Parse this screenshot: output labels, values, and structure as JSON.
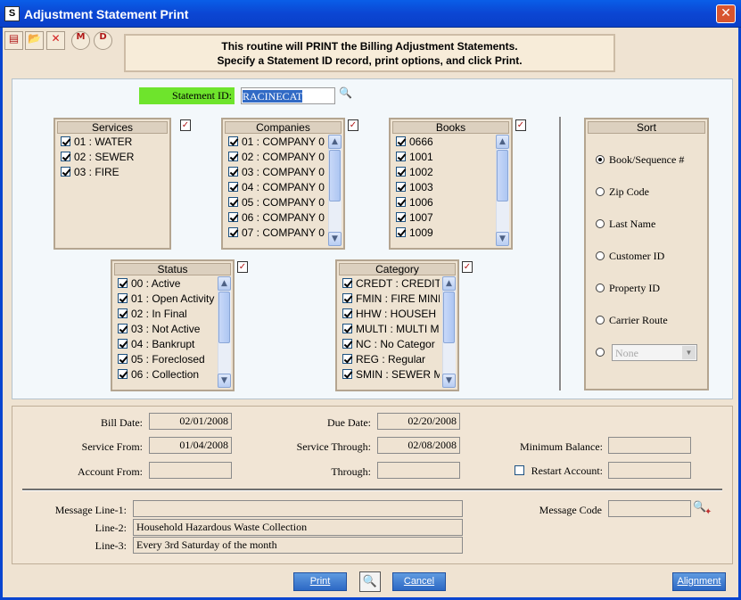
{
  "window": {
    "title": "Adjustment Statement Print",
    "icon_letter": "S",
    "close_glyph": "✕"
  },
  "toolbar": {
    "icons": [
      {
        "name": "print-icon",
        "glyph": "▤",
        "color": "#b01818"
      },
      {
        "name": "open-folder-icon",
        "glyph": "📂",
        "color": "#c79320"
      },
      {
        "name": "delete-x-icon",
        "glyph": "✕",
        "color": "#d42020"
      },
      {
        "name": "m-icon",
        "glyph": "M",
        "color": "#b01818"
      },
      {
        "name": "d-icon",
        "glyph": "D",
        "color": "#b01818"
      }
    ]
  },
  "banner": {
    "line1": "This routine will PRINT the Billing Adjustment Statements.",
    "line2": "Specify a Statement ID record, print options, and click Print."
  },
  "statement_id": {
    "label": "Statement ID:",
    "value": "RACINECAT"
  },
  "services": {
    "title": "Services",
    "items": [
      "01 : WATER",
      "02 : SEWER",
      "03 : FIRE"
    ]
  },
  "companies": {
    "title": "Companies",
    "items": [
      "01 : COMPANY 0",
      "02 : COMPANY 0",
      "03 : COMPANY 0",
      "04 : COMPANY 0",
      "05 : COMPANY 0",
      "06 : COMPANY 0",
      "07 : COMPANY 0"
    ]
  },
  "books": {
    "title": "Books",
    "items": [
      "0666",
      "1001",
      "1002",
      "1003",
      "1006",
      "1007",
      "1009"
    ]
  },
  "status": {
    "title": "Status",
    "items": [
      "00 : Active",
      "01 : Open Activity",
      "02 : In Final",
      "03 : Not Active",
      "04 : Bankrupt",
      "05 : Foreclosed",
      "06 : Collection"
    ]
  },
  "category": {
    "title": "Category",
    "items": [
      "CREDT : CREDIT",
      "FMIN : FIRE MINI",
      "HHW : HOUSEH",
      "MULTI : MULTI M",
      "NC : No Categor",
      "REG : Regular",
      "SMIN : SEWER M"
    ]
  },
  "sort": {
    "title": "Sort",
    "options": [
      "Book/Sequence #",
      "Zip Code",
      "Last Name",
      "Customer ID",
      "Property ID",
      "Carrier Route"
    ],
    "selected": "Book/Sequence #",
    "none_select": "None"
  },
  "fields": {
    "bill_date": {
      "label": "Bill Date:",
      "value": "02/01/2008"
    },
    "due_date": {
      "label": "Due Date:",
      "value": "02/20/2008"
    },
    "service_from": {
      "label": "Service From:",
      "value": "01/04/2008"
    },
    "service_through": {
      "label": "Service Through:",
      "value": "02/08/2008"
    },
    "minimum_balance": {
      "label": "Minimum Balance:",
      "value": ""
    },
    "account_from": {
      "label": "Account From:",
      "value": ""
    },
    "through": {
      "label": "Through:",
      "value": ""
    },
    "restart_account": {
      "label": "Restart Account:",
      "value": ""
    },
    "message_line1": {
      "label": "Message Line-1:",
      "value": ""
    },
    "line2": {
      "label": "Line-2:",
      "value": "Household Hazardous Waste Collection"
    },
    "line3": {
      "label": "Line-3:",
      "value": "Every 3rd Saturday of the month"
    },
    "message_code": {
      "label": "Message Code",
      "value": ""
    }
  },
  "buttons": {
    "print": "Print",
    "cancel": "Cancel",
    "alignment": "Alignment"
  },
  "colors": {
    "title_bar": "#0b46d3",
    "statement_label_bg": "#6ee42c",
    "button_blue": "#2c68c4",
    "selection": "#316ac5"
  }
}
